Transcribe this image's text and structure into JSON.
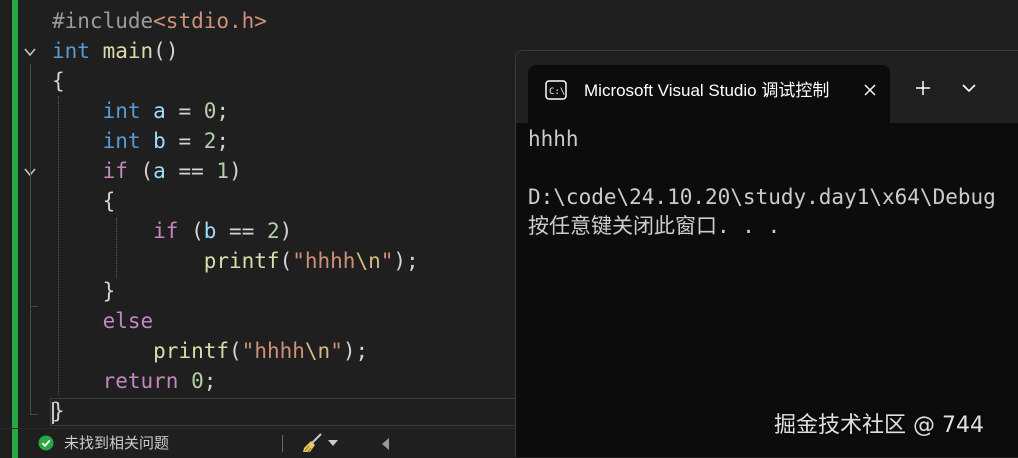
{
  "editor": {
    "lines": [
      [
        {
          "t": "#include",
          "c": "pre"
        },
        {
          "t": "<stdio.h>",
          "c": "inc"
        }
      ],
      [
        {
          "t": "int",
          "c": "kw"
        },
        {
          "t": " "
        },
        {
          "t": "main",
          "c": "fn"
        },
        {
          "t": "()"
        }
      ],
      [
        {
          "t": "{"
        }
      ],
      [
        {
          "t": "    "
        },
        {
          "t": "int",
          "c": "kw"
        },
        {
          "t": " "
        },
        {
          "t": "a",
          "c": "var"
        },
        {
          "t": " = "
        },
        {
          "t": "0",
          "c": "num"
        },
        {
          "t": ";"
        }
      ],
      [
        {
          "t": "    "
        },
        {
          "t": "int",
          "c": "kw"
        },
        {
          "t": " "
        },
        {
          "t": "b",
          "c": "var"
        },
        {
          "t": " = "
        },
        {
          "t": "2",
          "c": "num"
        },
        {
          "t": ";"
        }
      ],
      [
        {
          "t": "    "
        },
        {
          "t": "if",
          "c": "ctl"
        },
        {
          "t": " ("
        },
        {
          "t": "a",
          "c": "var"
        },
        {
          "t": " == "
        },
        {
          "t": "1",
          "c": "num"
        },
        {
          "t": ")"
        }
      ],
      [
        {
          "t": "    {"
        }
      ],
      [
        {
          "t": "        "
        },
        {
          "t": "if",
          "c": "ctl"
        },
        {
          "t": " ("
        },
        {
          "t": "b",
          "c": "var"
        },
        {
          "t": " == "
        },
        {
          "t": "2",
          "c": "num"
        },
        {
          "t": ")"
        }
      ],
      [
        {
          "t": "            "
        },
        {
          "t": "printf",
          "c": "fn"
        },
        {
          "t": "("
        },
        {
          "t": "\"hhhh",
          "c": "str"
        },
        {
          "t": "\\n",
          "c": "esc"
        },
        {
          "t": "\"",
          "c": "str"
        },
        {
          "t": ");"
        }
      ],
      [
        {
          "t": "    }"
        }
      ],
      [
        {
          "t": "    "
        },
        {
          "t": "else",
          "c": "ctl"
        }
      ],
      [
        {
          "t": "        "
        },
        {
          "t": "printf",
          "c": "fn"
        },
        {
          "t": "("
        },
        {
          "t": "\"hhhh",
          "c": "str"
        },
        {
          "t": "\\n",
          "c": "esc"
        },
        {
          "t": "\"",
          "c": "str"
        },
        {
          "t": ");"
        }
      ],
      [
        {
          "t": "    "
        },
        {
          "t": "return",
          "c": "ctl"
        },
        {
          "t": " "
        },
        {
          "t": "0",
          "c": "num"
        },
        {
          "t": ";"
        }
      ],
      [
        {
          "t": "}"
        }
      ]
    ]
  },
  "status": {
    "message": "未找到相关问题",
    "ok_icon": "check-circle-icon",
    "brush_icon": "cleanup-brush-icon",
    "accent": "#28a745"
  },
  "terminal": {
    "tab_title": "Microsoft Visual Studio 调试控制台",
    "output": [
      "hhhh",
      "",
      "D:\\code\\24.10.20\\study.day1\\x64\\Debug",
      "按任意键关闭此窗口. . ."
    ],
    "icons": [
      "console-icon",
      "close-icon",
      "plus-icon",
      "chevron-down-icon"
    ]
  },
  "watermark": "掘金技术社区 @ 744"
}
